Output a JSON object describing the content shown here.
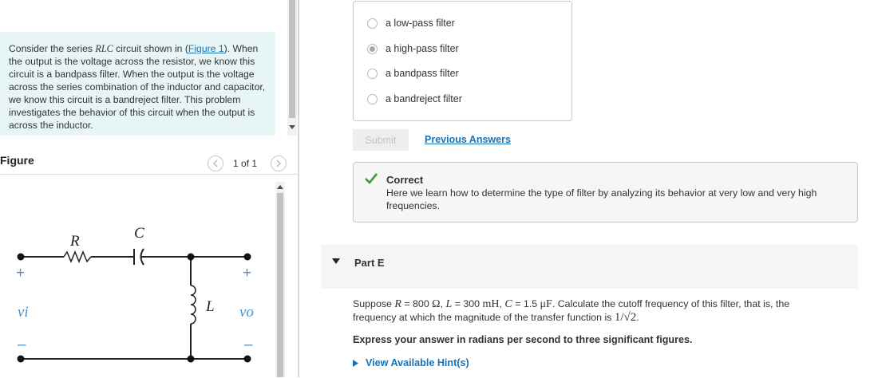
{
  "intro": {
    "line1_pre": "Consider the series ",
    "rlc": "RLC",
    "line1_post": " circuit shown in (",
    "figure_link": "Figure 1",
    "line1_end": ").",
    "rest": "When the output is the voltage across the resistor, we know this circuit is a bandpass filter. When the output is the voltage across the series combination of the inductor and capacitor, we know this circuit is a bandreject filter. This problem investigates the behavior of this circuit when the output is across the inductor."
  },
  "figure": {
    "title": "Figure",
    "count": "1 of 1",
    "prev_icon": "chevron-left-icon",
    "next_icon": "chevron-right-icon",
    "labels": {
      "R": "R",
      "C": "C",
      "L": "L",
      "vi": "vi",
      "vo": "vo",
      "plus": "+",
      "minus": "–"
    }
  },
  "options": [
    {
      "label": "a low-pass filter",
      "selected": false
    },
    {
      "label": "a high-pass filter",
      "selected": true
    },
    {
      "label": "a bandpass filter",
      "selected": false
    },
    {
      "label": "a bandreject filter",
      "selected": false
    }
  ],
  "submit_label": "Submit",
  "previous_answers_label": "Previous Answers",
  "feedback": {
    "title": "Correct",
    "text": "Here we learn how to determine the type of filter by analyzing its behavior at very low and very high frequencies.",
    "icon": "check-icon",
    "color": "#3a9a3a"
  },
  "partE": {
    "label": "Part E",
    "problem_pre": "Suppose ",
    "R": "R",
    "eq_R": " = 800 ",
    "ohm": "Ω",
    "sep1": ", ",
    "L": "L",
    "eq_L": " = 300 ",
    "mH": "mH",
    "sep2": ", ",
    "C": "C",
    "eq_C": " = 1.5 ",
    "uF": "μF",
    "problem_post": ". Calculate the cutoff frequency of this filter, that is, the",
    "line2": "frequency at which the magnitude of the transfer function is ",
    "math_end": "1/√2",
    "period": ".",
    "instruction": "Express your answer in radians per second to three significant figures.",
    "hint": "View Available Hint(s)"
  },
  "colors": {
    "link": "#1a73b8",
    "intro_bg": "#e8f5f7",
    "circuit_terminal": "#4a90c8"
  }
}
